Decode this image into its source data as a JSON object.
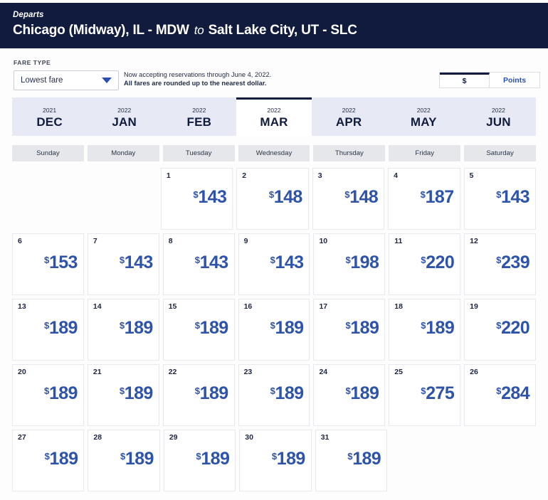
{
  "header": {
    "departs_label": "Departs",
    "origin": "Chicago (Midway), IL - MDW",
    "connector": "to",
    "destination": "Salt Lake City, UT - SLC",
    "background_color": "#111b3d"
  },
  "controls": {
    "fare_type_label": "FARE TYPE",
    "fare_type_value": "Lowest fare",
    "fare_type_options": [
      "Lowest fare"
    ],
    "notice_line1": "Now accepting reservations through June 4, 2022.",
    "notice_line2": "All fares are rounded up to the nearest dollar.",
    "currency_toggle": {
      "dollar_label": "$",
      "points_label": "Points",
      "selected": "$"
    }
  },
  "month_tabs": [
    {
      "year": "2021",
      "month": "DEC",
      "active": false
    },
    {
      "year": "2022",
      "month": "JAN",
      "active": false
    },
    {
      "year": "2022",
      "month": "FEB",
      "active": false
    },
    {
      "year": "2022",
      "month": "MAR",
      "active": true
    },
    {
      "year": "2022",
      "month": "APR",
      "active": false
    },
    {
      "year": "2022",
      "month": "MAY",
      "active": false
    },
    {
      "year": "2022",
      "month": "JUN",
      "active": false
    }
  ],
  "weekdays": [
    "Sunday",
    "Monday",
    "Tuesday",
    "Wednesday",
    "Thursday",
    "Friday",
    "Saturday"
  ],
  "calendar": {
    "currency_symbol": "$",
    "fare_color": "#2d53ab",
    "weeks": [
      [
        {
          "day": "",
          "fare": ""
        },
        {
          "day": "",
          "fare": ""
        },
        {
          "day": "1",
          "fare": "143"
        },
        {
          "day": "2",
          "fare": "148"
        },
        {
          "day": "3",
          "fare": "148"
        },
        {
          "day": "4",
          "fare": "187"
        },
        {
          "day": "5",
          "fare": "143"
        }
      ],
      [
        {
          "day": "6",
          "fare": "153"
        },
        {
          "day": "7",
          "fare": "143"
        },
        {
          "day": "8",
          "fare": "143"
        },
        {
          "day": "9",
          "fare": "143"
        },
        {
          "day": "10",
          "fare": "198"
        },
        {
          "day": "11",
          "fare": "220"
        },
        {
          "day": "12",
          "fare": "239"
        }
      ],
      [
        {
          "day": "13",
          "fare": "189"
        },
        {
          "day": "14",
          "fare": "189"
        },
        {
          "day": "15",
          "fare": "189"
        },
        {
          "day": "16",
          "fare": "189"
        },
        {
          "day": "17",
          "fare": "189"
        },
        {
          "day": "18",
          "fare": "189"
        },
        {
          "day": "19",
          "fare": "220"
        }
      ],
      [
        {
          "day": "20",
          "fare": "189"
        },
        {
          "day": "21",
          "fare": "189"
        },
        {
          "day": "22",
          "fare": "189"
        },
        {
          "day": "23",
          "fare": "189"
        },
        {
          "day": "24",
          "fare": "189"
        },
        {
          "day": "25",
          "fare": "275"
        },
        {
          "day": "26",
          "fare": "284"
        }
      ],
      [
        {
          "day": "27",
          "fare": "189"
        },
        {
          "day": "28",
          "fare": "189"
        },
        {
          "day": "29",
          "fare": "189"
        },
        {
          "day": "30",
          "fare": "189"
        },
        {
          "day": "31",
          "fare": "189"
        },
        {
          "day": "",
          "fare": ""
        },
        {
          "day": "",
          "fare": ""
        }
      ]
    ]
  }
}
